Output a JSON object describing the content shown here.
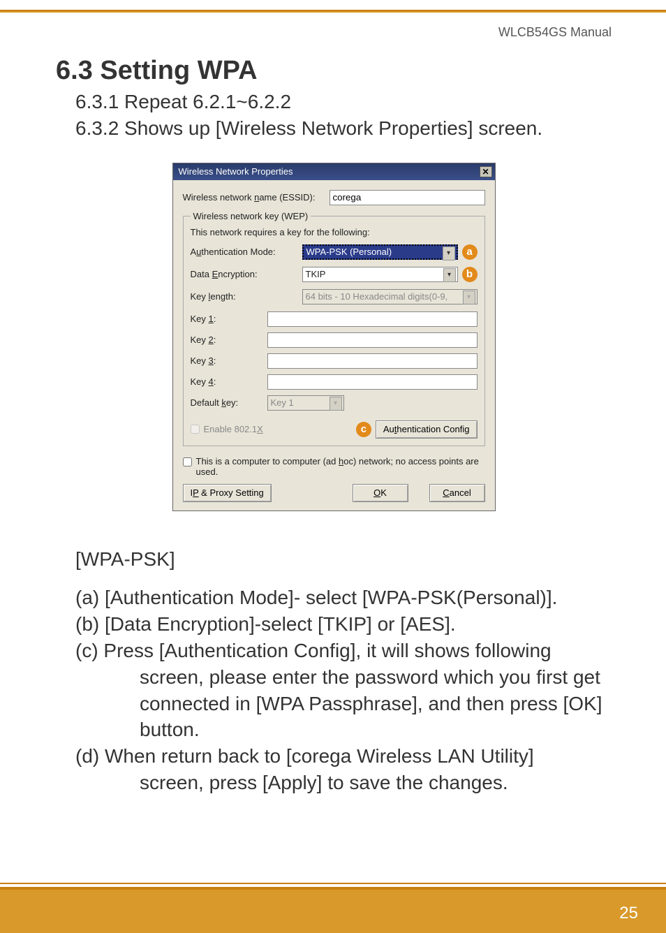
{
  "header": {
    "manual": "WLCB54GS Manual"
  },
  "section": {
    "title": "6.3 Setting WPA",
    "sub1": "6.3.1 Repeat 6.2.1~6.2.2",
    "sub2": "6.3.2 Shows up [Wireless Network Properties] screen."
  },
  "dialog": {
    "title": "Wireless Network Properties",
    "essid_label": "Wireless network name (ESSID):",
    "essid_value": "corega",
    "wep_legend": "Wireless network key (WEP)",
    "wep_note": "This network requires a key for the following:",
    "auth_label": "Authentication Mode:",
    "auth_value": "WPA-PSK (Personal)",
    "enc_label": "Data Encryption:",
    "enc_value": "TKIP",
    "keylen_label": "Key length:",
    "keylen_value": "64 bits - 10 Hexadecimal digits(0-9,",
    "key1": "Key 1:",
    "key2": "Key 2:",
    "key3": "Key 3:",
    "key4": "Key 4:",
    "defkey_label": "Default key:",
    "defkey_value": "Key 1",
    "enable8021x": "Enable 802.1X",
    "authcfg_btn": "Authentication Config",
    "adhoc": "This is a computer to computer (ad hoc) network; no access points are used.",
    "ipproxy_btn": "IP & Proxy Setting",
    "ok_btn": "OK",
    "cancel_btn": "Cancel",
    "badge_a": "a",
    "badge_b": "b",
    "badge_c": "c"
  },
  "instr": {
    "hdr": "[WPA-PSK]",
    "a": "(a) [Authentication Mode]- select [WPA-PSK(Personal)].",
    "b": "(b) [Data Encryption]-select [TKIP] or [AES].",
    "c1": "(c) Press [Authentication Config], it will shows following",
    "c2": "screen, please enter the password which you first get",
    "c3": "connected in [WPA Passphrase], and then press [OK]",
    "c4": "button.",
    "d1": "(d) When return back to [corega Wireless LAN Utility]",
    "d2": "screen, press [Apply] to save the changes."
  },
  "page": "25"
}
